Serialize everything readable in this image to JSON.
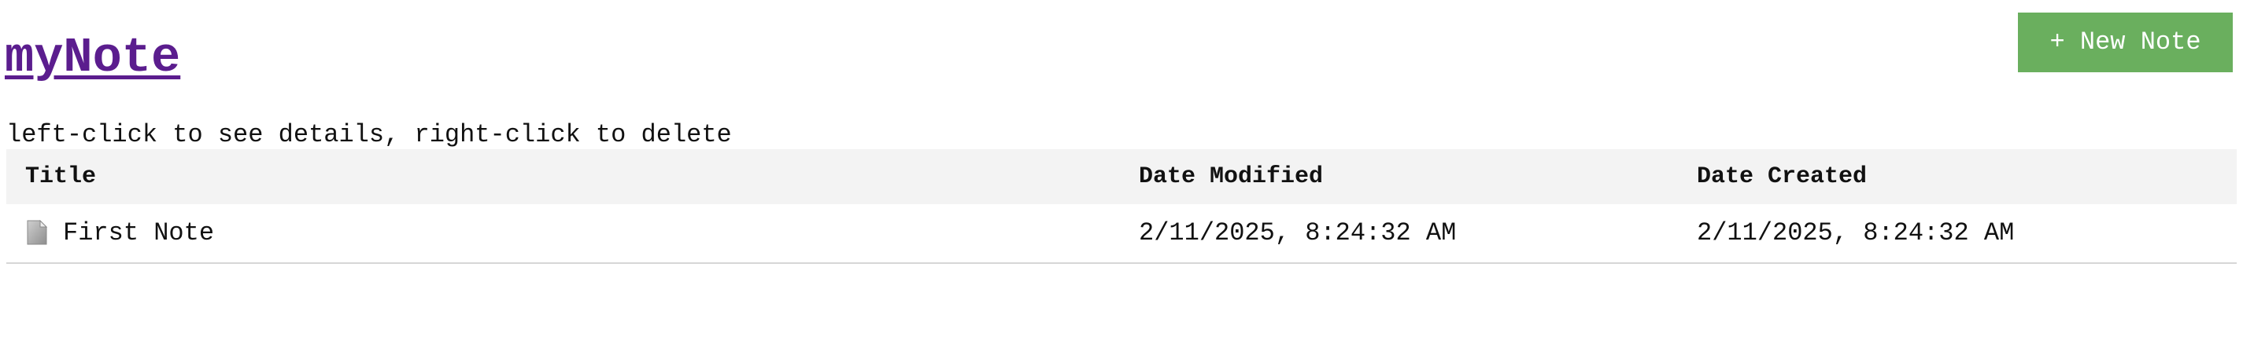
{
  "app": {
    "title": "myNote"
  },
  "toolbar": {
    "new_note_label": "+ New Note"
  },
  "hint_text": "left-click to see details, right-click to delete",
  "table": {
    "columns": [
      "Title",
      "Date Modified",
      "Date Created"
    ],
    "rows": [
      {
        "icon": "document-icon",
        "title": "First Note",
        "modified": "2/11/2025, 8:24:32 AM",
        "created": "2/11/2025, 8:24:32 AM"
      }
    ]
  },
  "colors": {
    "title_link": "#5b1d8e",
    "button_bg": "#6aaf5e",
    "header_bg": "#f3f3f3"
  }
}
